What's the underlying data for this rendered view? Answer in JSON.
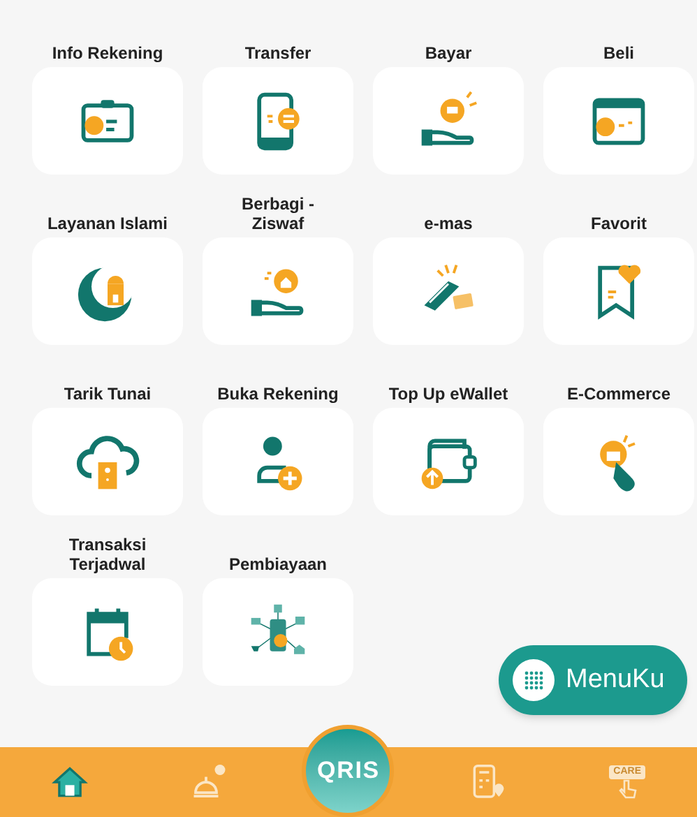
{
  "menu_items": [
    {
      "label": "Info Rekening",
      "kind": "id-card"
    },
    {
      "label": "Transfer",
      "kind": "phone-transfer"
    },
    {
      "label": "Bayar",
      "kind": "hand-coin"
    },
    {
      "label": "Beli",
      "kind": "shop-window"
    },
    {
      "label": "Layanan Islami",
      "kind": "crescent"
    },
    {
      "label": "Berbagi - Ziswaf",
      "kind": "hand-house"
    },
    {
      "label": "e-mas",
      "kind": "gold-bar"
    },
    {
      "label": "Favorit",
      "kind": "bookmark-heart"
    },
    {
      "label": "Tarik Tunai",
      "kind": "cloud-atm"
    },
    {
      "label": "Buka Rekening",
      "kind": "user-plus"
    },
    {
      "label": "Top Up eWallet",
      "kind": "wallet-up"
    },
    {
      "label": "E-Commerce",
      "kind": "tap-bag"
    },
    {
      "label": "Transaksi Terjadwal",
      "kind": "calendar-clock"
    },
    {
      "label": "Pembiayaan",
      "kind": "phone-network"
    }
  ],
  "menuku_button": {
    "label": "MenuKu"
  },
  "bottom_nav": [
    {
      "kind": "home",
      "selected": true
    },
    {
      "kind": "mosque",
      "selected": false
    },
    {
      "kind": "qris",
      "label": "QRIS",
      "selected": false
    },
    {
      "kind": "atm-location",
      "selected": false
    },
    {
      "kind": "care",
      "label": "CARE",
      "selected": false
    }
  ]
}
